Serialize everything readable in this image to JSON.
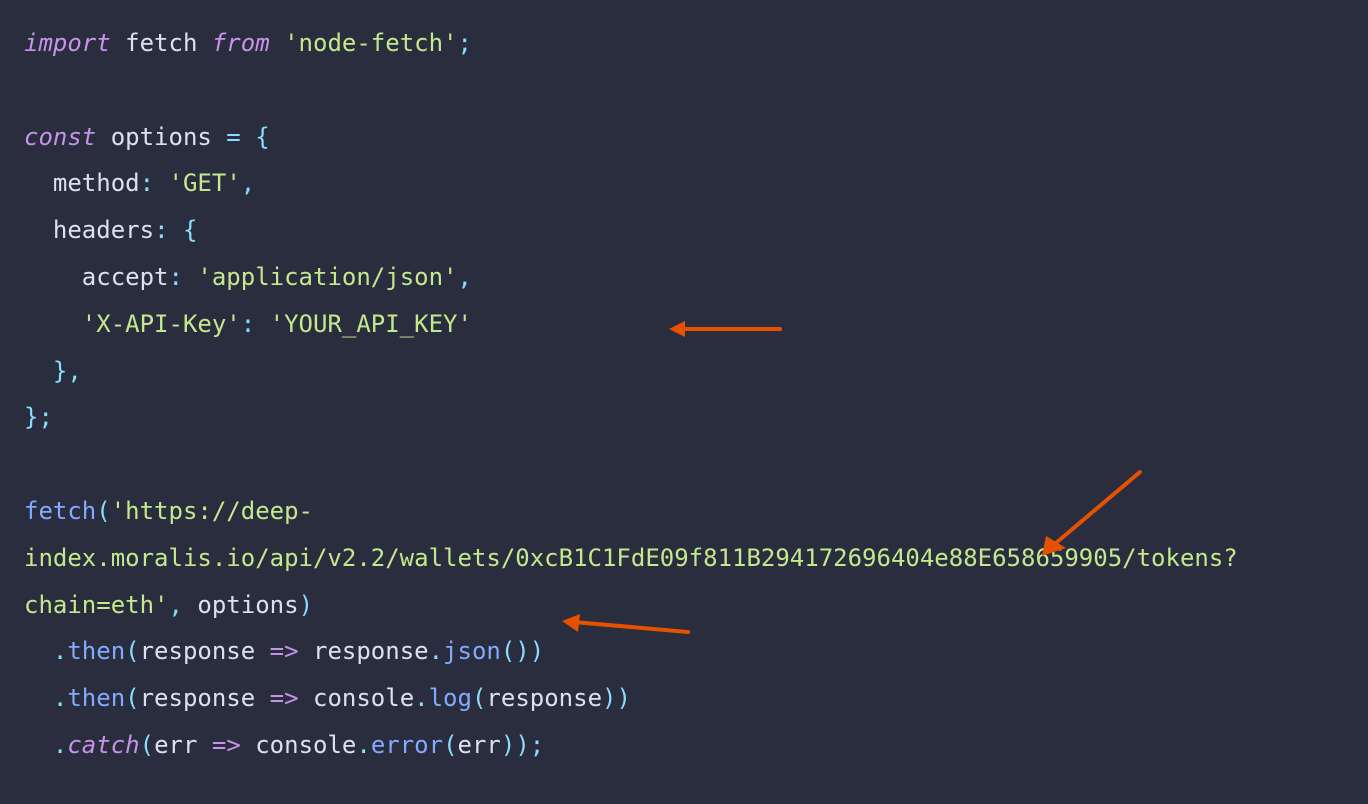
{
  "code": {
    "line1": {
      "import": "import",
      "fetch": " fetch ",
      "from": "from",
      "pkg": " 'node-fetch'",
      "semi": ";"
    },
    "line3a": {
      "const": "const",
      "name": " options ",
      "eq": "=",
      "brace": " {"
    },
    "line4": {
      "indent": "  ",
      "prop": "method",
      "colon": ": ",
      "val": "'GET'",
      "comma": ","
    },
    "line5": {
      "indent": "  ",
      "prop": "headers",
      "colon": ": ",
      "brace": "{"
    },
    "line6": {
      "indent": "    ",
      "prop": "accept",
      "colon": ": ",
      "val": "'application/json'",
      "comma": ","
    },
    "line7": {
      "indent": "    ",
      "prop": "'X-API-Key'",
      "colon": ": ",
      "val": "'YOUR_API_KEY'"
    },
    "line8": {
      "indent": "  ",
      "brace": "},"
    },
    "line9": {
      "brace": "};"
    },
    "line11": {
      "fn": "fetch",
      "p1": "(",
      "url": "'https://deep-index.moralis.io/api/v2.2/wallets/0xcB1C1FdE09f811B294172696404e88E658659905/tokens?chain=eth'",
      "comma": ", ",
      "opts": "options",
      "p2": ")"
    },
    "line12": {
      "indent": "  ",
      "dot": ".",
      "then": "then",
      "p1": "(",
      "param": "response",
      "arrow": " => ",
      "param2": "response",
      "dot2": ".",
      "json": "json",
      "p3": "()",
      "p2": ")"
    },
    "line13": {
      "indent": "  ",
      "dot": ".",
      "then": "then",
      "p1": "(",
      "param": "response",
      "arrow": " => ",
      "console": "console",
      "dot2": ".",
      "log": "log",
      "p3": "(",
      "param2": "response",
      "p4": ")",
      "p2": ")"
    },
    "line14": {
      "indent": "  ",
      "dot": ".",
      "catch": "catch",
      "p1": "(",
      "param": "err",
      "arrow": " => ",
      "console": "console",
      "dot2": ".",
      "error": "error",
      "p3": "(",
      "param2": "err",
      "p4": ")",
      "p2": ")",
      "semi": ";"
    }
  },
  "annotations": {
    "arrow_color": "#e65100"
  }
}
